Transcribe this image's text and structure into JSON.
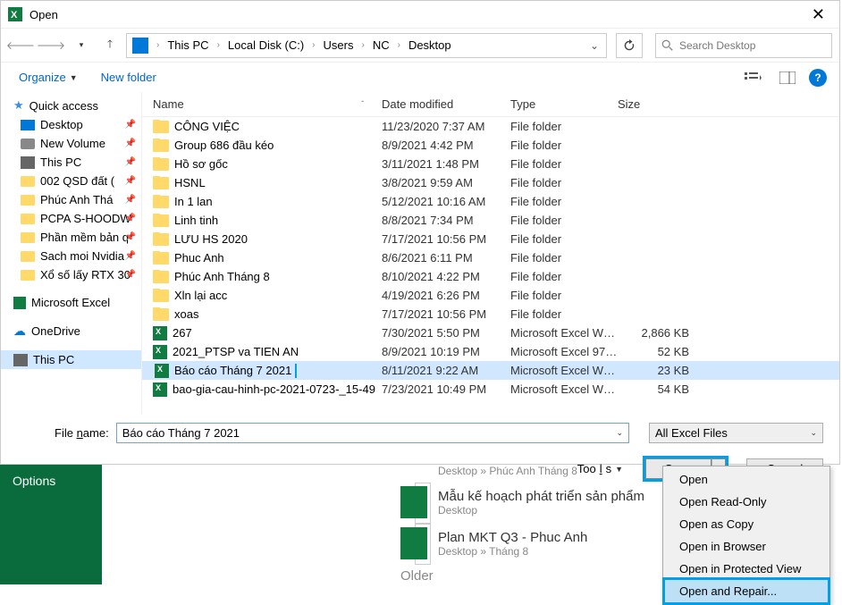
{
  "titlebar": {
    "title": "Open"
  },
  "breadcrumb": [
    "This PC",
    "Local Disk (C:)",
    "Users",
    "NC",
    "Desktop"
  ],
  "search": {
    "placeholder": "Search Desktop"
  },
  "toolbar": {
    "organize": "Organize",
    "newfolder": "New folder"
  },
  "sidebar": [
    {
      "label": "Quick access",
      "icon": "star",
      "top": true
    },
    {
      "label": "Desktop",
      "icon": "desktop",
      "pin": true
    },
    {
      "label": "New Volume",
      "icon": "drive",
      "pin": true
    },
    {
      "label": "This PC",
      "icon": "pc",
      "pin": true
    },
    {
      "label": "002 QSD đất (",
      "icon": "folder",
      "pin": true
    },
    {
      "label": "Phúc Anh Thá",
      "icon": "folder",
      "pin": true
    },
    {
      "label": "PCPA S-HOODW",
      "icon": "folder",
      "pin": true
    },
    {
      "label": "Phần mềm bản q",
      "icon": "folder",
      "pin": true
    },
    {
      "label": "Sach moi Nvidia",
      "icon": "folder",
      "pin": true
    },
    {
      "label": "Xổ số lấy RTX 30",
      "icon": "folder",
      "pin": true
    },
    {
      "label": "Microsoft Excel",
      "icon": "excel",
      "top": true,
      "spacer": true
    },
    {
      "label": "OneDrive",
      "icon": "cloud",
      "top": true,
      "spacer": true
    },
    {
      "label": "This PC",
      "icon": "pc",
      "top": true,
      "sel": true,
      "spacer": true
    }
  ],
  "columns": {
    "name": "Name",
    "date": "Date modified",
    "type": "Type",
    "size": "Size"
  },
  "files": [
    {
      "name": "CÔNG VIỆC",
      "date": "11/23/2020 7:37 AM",
      "type": "File folder",
      "size": "",
      "icon": "folder"
    },
    {
      "name": "Group 686 đầu kéo",
      "date": "8/9/2021 4:42 PM",
      "type": "File folder",
      "size": "",
      "icon": "folder"
    },
    {
      "name": "Hồ sơ gốc",
      "date": "3/11/2021 1:48 PM",
      "type": "File folder",
      "size": "",
      "icon": "folder"
    },
    {
      "name": "HSNL",
      "date": "3/8/2021 9:59 AM",
      "type": "File folder",
      "size": "",
      "icon": "folder"
    },
    {
      "name": "In 1 lan",
      "date": "5/12/2021 10:16 AM",
      "type": "File folder",
      "size": "",
      "icon": "folder"
    },
    {
      "name": "Linh tinh",
      "date": "8/8/2021 7:34 PM",
      "type": "File folder",
      "size": "",
      "icon": "folder"
    },
    {
      "name": "LƯU HS 2020",
      "date": "7/17/2021 10:56 PM",
      "type": "File folder",
      "size": "",
      "icon": "folder"
    },
    {
      "name": "Phuc Anh",
      "date": "8/6/2021 6:11 PM",
      "type": "File folder",
      "size": "",
      "icon": "folder"
    },
    {
      "name": "Phúc Anh Tháng 8",
      "date": "8/10/2021 4:22 PM",
      "type": "File folder",
      "size": "",
      "icon": "folder"
    },
    {
      "name": "Xln lại acc",
      "date": "4/19/2021 6:26 PM",
      "type": "File folder",
      "size": "",
      "icon": "folder"
    },
    {
      "name": "xoas",
      "date": "7/17/2021 10:56 PM",
      "type": "File folder",
      "size": "",
      "icon": "folder"
    },
    {
      "name": "267",
      "date": "7/30/2021 5:50 PM",
      "type": "Microsoft Excel W…",
      "size": "2,866 KB",
      "icon": "xl"
    },
    {
      "name": "2021_PTSP va TIEN AN",
      "date": "8/9/2021 10:19 PM",
      "type": "Microsoft Excel 97…",
      "size": "52 KB",
      "icon": "xl"
    },
    {
      "name": "Báo cáo Tháng 7 2021",
      "date": "8/11/2021 9:22 AM",
      "type": "Microsoft Excel W…",
      "size": "23 KB",
      "icon": "xl",
      "sel": true,
      "hlname": true
    },
    {
      "name": "bao-gia-cau-hinh-pc-2021-0723-_15-49",
      "date": "7/23/2021 10:49 PM",
      "type": "Microsoft Excel W…",
      "size": "54 KB",
      "icon": "xl"
    }
  ],
  "bottom": {
    "filename_label": "File name:",
    "filename_value": "Báo cáo Tháng 7 2021",
    "filetype": "All Excel Files",
    "tools": "Tools",
    "open": "Open",
    "cancel": "Cancel"
  },
  "menu": [
    "Open",
    "Open Read-Only",
    "Open as Copy",
    "Open in Browser",
    "Open in Protected View",
    "Open and Repair..."
  ],
  "menu_hl_index": 5,
  "bg": {
    "options": "Options",
    "row0_path": "Desktop » Phúc Anh Tháng 8",
    "row1_title": "Mẫu kế hoạch phát triển sản phẩm",
    "row1_path": "Desktop",
    "row2_title": "Plan MKT Q3 - Phuc Anh",
    "row2_path": "Desktop » Tháng 8",
    "older": "Older"
  }
}
